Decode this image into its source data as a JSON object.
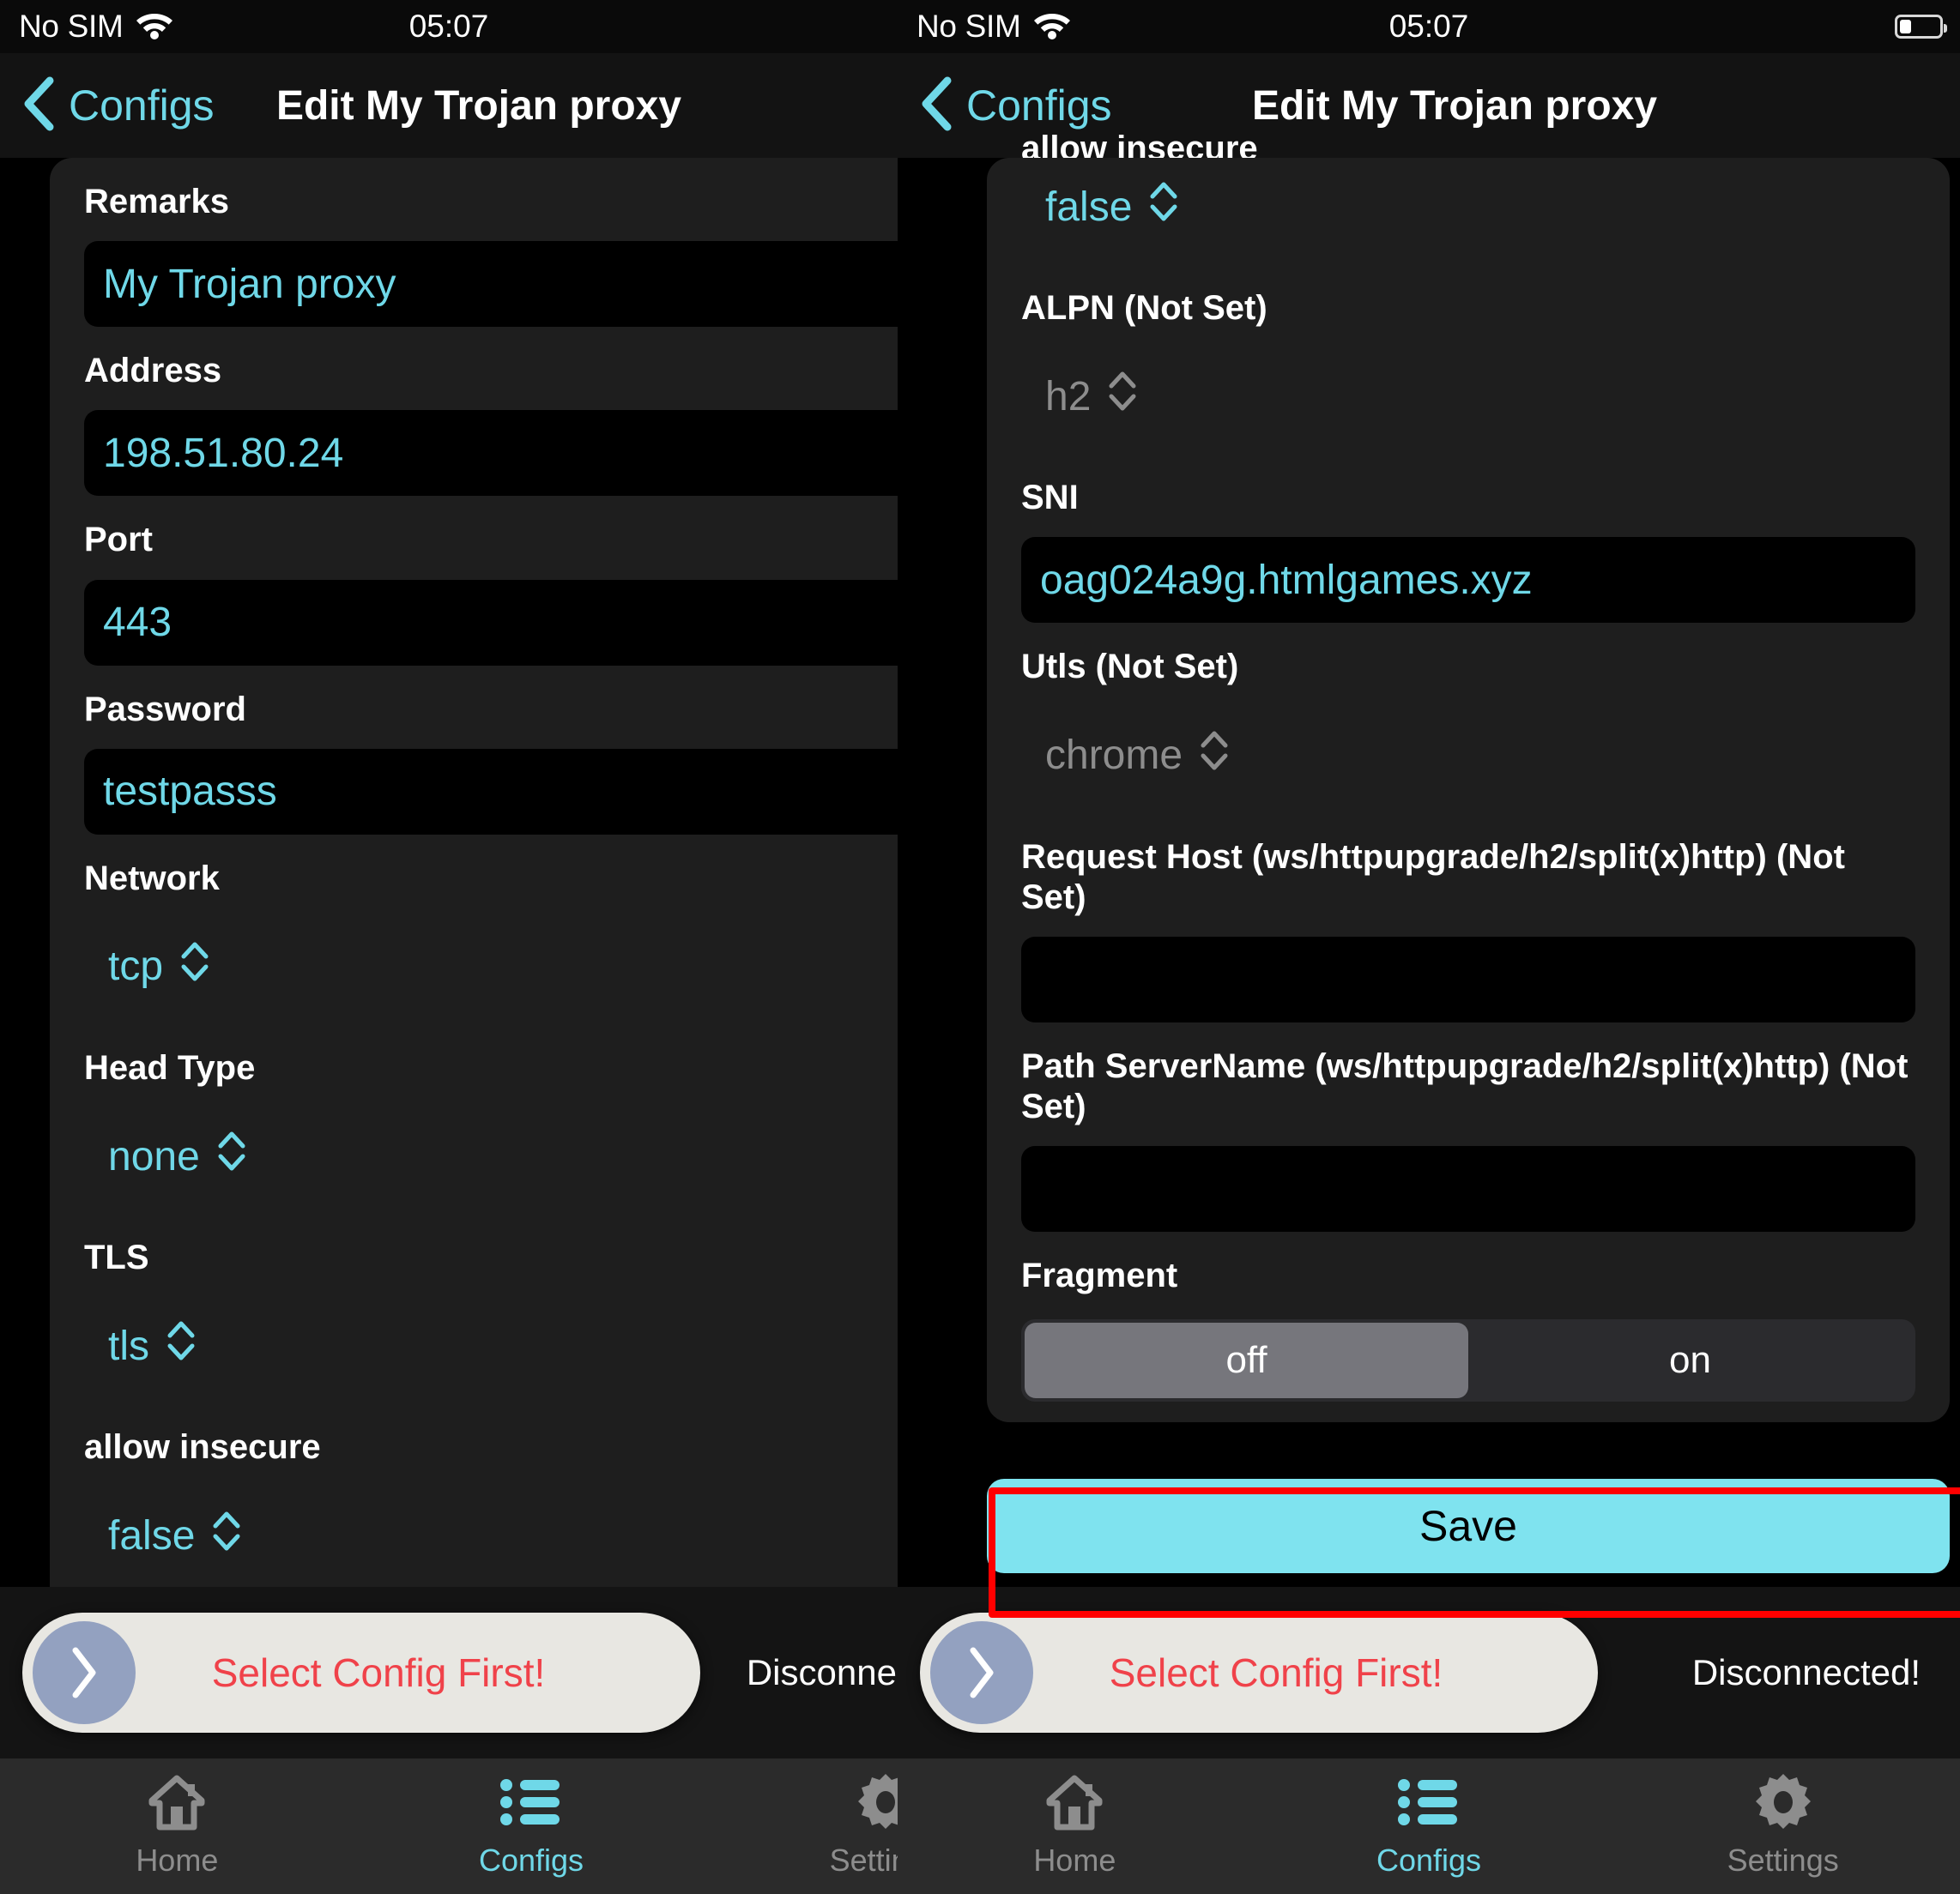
{
  "status_bar": {
    "carrier": "No SIM",
    "time": "05:07",
    "wifi_icon": "wifi-icon",
    "battery_icon": "battery-icon"
  },
  "nav": {
    "back_label": "Configs",
    "back_icon": "chevron-left-icon",
    "title": "Edit My Trojan proxy"
  },
  "left_panel": {
    "fields": [
      {
        "label": "Remarks",
        "value": "My Trojan proxy"
      },
      {
        "label": "Address",
        "value": "198.51.80.24"
      },
      {
        "label": "Port",
        "value": "443"
      },
      {
        "label": "Password",
        "value": "testpasss"
      }
    ],
    "pickers": [
      {
        "label": "Network",
        "value": "tcp"
      },
      {
        "label": "Head Type",
        "value": "none"
      },
      {
        "label": "TLS",
        "value": "tls"
      },
      {
        "label": "allow insecure",
        "value": "false"
      }
    ],
    "trailing_label": "ALPN (Not Set)"
  },
  "right_panel": {
    "cut_label": "allow insecure",
    "allow_insecure_value": "false",
    "alpn_label": "ALPN (Not Set)",
    "alpn_value": "h2",
    "sni_label": "SNI",
    "sni_value": "oag024a9g.htmlgames.xyz",
    "utls_label": "Utls (Not Set)",
    "utls_value": "chrome",
    "request_host_label": "Request Host (ws/httpupgrade/h2/split(x)http) (Not Set)",
    "request_host_value": "",
    "path_servername_label": "Path ServerName (ws/httpupgrade/h2/split(x)http) (Not Set)",
    "path_servername_value": "",
    "fragment_label": "Fragment",
    "fragment_options": [
      "off",
      "on"
    ],
    "fragment_selected": "off",
    "save_label": "Save"
  },
  "annotation": {
    "color": "#ff0000"
  },
  "toast": {
    "message": "Select Config First!",
    "status_full": "Disconnected!",
    "status_clipped": "Disconn",
    "arrow_icon": "chevron-right-icon"
  },
  "tabbar": {
    "items": [
      {
        "label": "Home",
        "icon": "home-icon",
        "active": false
      },
      {
        "label": "Configs",
        "icon": "list-icon",
        "active": true
      },
      {
        "label": "Settings",
        "icon": "gear-icon",
        "active": false
      }
    ]
  },
  "colors": {
    "accent": "#6fd8e8",
    "save_bg": "#7fe3ef",
    "error": "#f0424a",
    "annotation": "#ff0000",
    "card_bg": "#1e1e1e"
  }
}
